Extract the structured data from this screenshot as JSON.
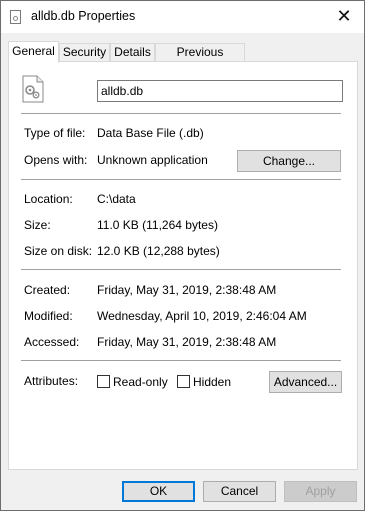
{
  "window": {
    "title": "alldb.db Properties",
    "close_glyph": "✕"
  },
  "tabs": [
    {
      "label": "General",
      "active": true
    },
    {
      "label": "Security",
      "active": false
    },
    {
      "label": "Details",
      "active": false
    },
    {
      "label": "Previous Versions",
      "active": false
    }
  ],
  "file": {
    "name": "alldb.db",
    "icon": "settings-file-icon"
  },
  "type": {
    "label": "Type of file:",
    "value": "Data Base File (.db)"
  },
  "opens": {
    "label": "Opens with:",
    "value": "Unknown application",
    "change_button": "Change..."
  },
  "location": {
    "label": "Location:",
    "value": "C:\\data"
  },
  "size": {
    "label": "Size:",
    "value": "11.0 KB (11,264 bytes)"
  },
  "size_on_disk": {
    "label": "Size on disk:",
    "value": "12.0 KB (12,288 bytes)"
  },
  "created": {
    "label": "Created:",
    "value": "Friday, May 31, 2019, 2:38:48 AM"
  },
  "modified": {
    "label": "Modified:",
    "value": "Wednesday, April 10, 2019, 2:46:04 AM"
  },
  "accessed": {
    "label": "Accessed:",
    "value": "Friday, May 31, 2019, 2:38:48 AM"
  },
  "attributes": {
    "label": "Attributes:",
    "readonly_label": "Read-only",
    "readonly_checked": false,
    "hidden_label": "Hidden",
    "hidden_checked": false,
    "advanced_button": "Advanced..."
  },
  "footer": {
    "ok": "OK",
    "cancel": "Cancel",
    "apply": "Apply"
  },
  "colors": {
    "accent": "#0078d7",
    "dialog_bg": "#f0f0f0",
    "panel_bg": "#ffffff"
  }
}
